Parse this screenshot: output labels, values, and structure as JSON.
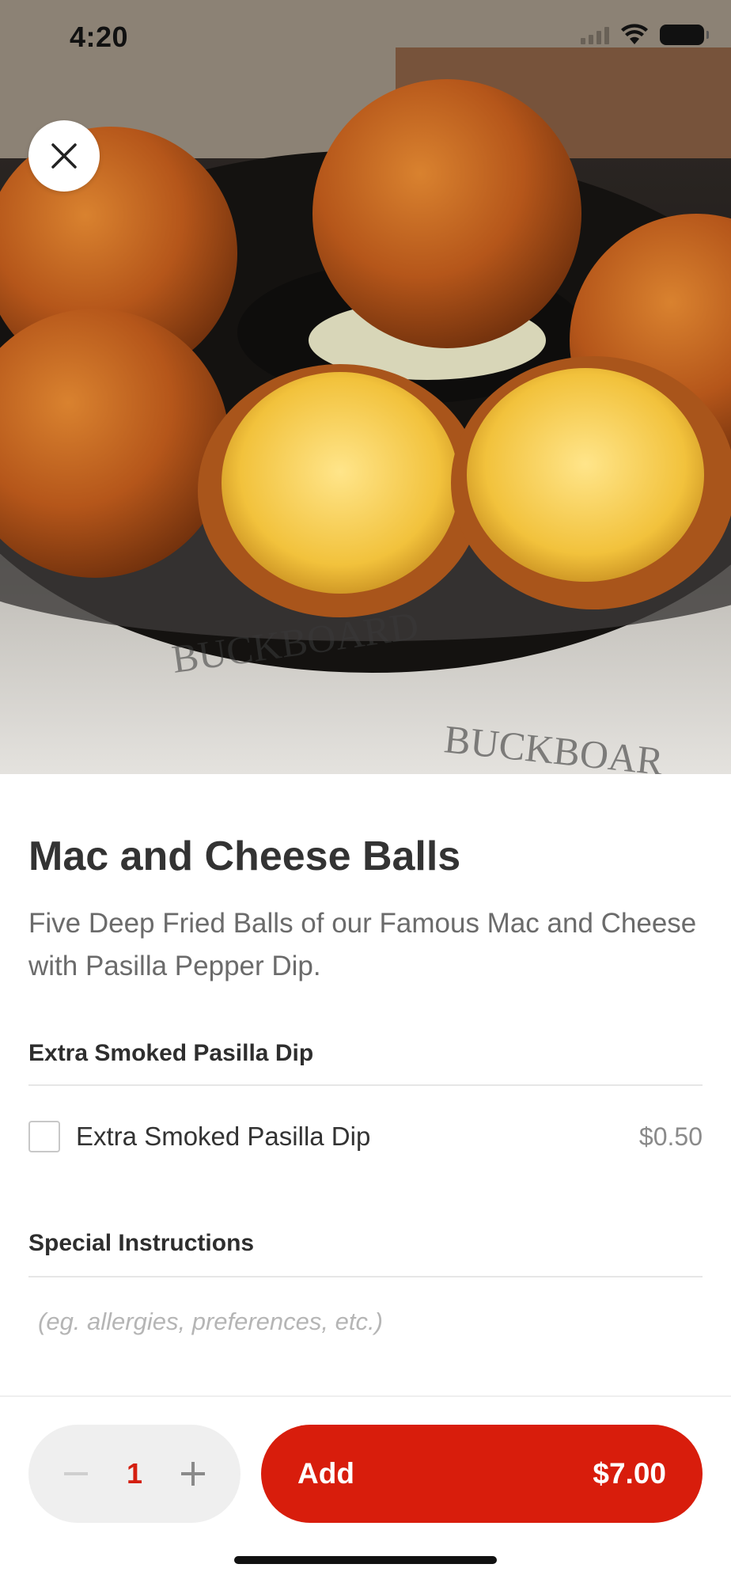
{
  "status_bar": {
    "time": "4:20"
  },
  "hero": {
    "image_description_icon": "food-photo"
  },
  "item": {
    "title": "Mac and Cheese Balls",
    "description": "Five Deep Fried Balls of our Famous Mac and Cheese with Pasilla Pepper Dip."
  },
  "modifiers": {
    "title": "Extra Smoked Pasilla Dip",
    "options": [
      {
        "label": "Extra Smoked Pasilla Dip",
        "price": "$0.50",
        "checked": false
      }
    ]
  },
  "instructions": {
    "title": "Special Instructions",
    "placeholder": "(eg. allergies, preferences, etc.)"
  },
  "cart": {
    "quantity": "1",
    "add_label": "Add",
    "total": "$7.00"
  },
  "colors": {
    "accent": "#d81d0c",
    "quantity": "#d41f10"
  }
}
